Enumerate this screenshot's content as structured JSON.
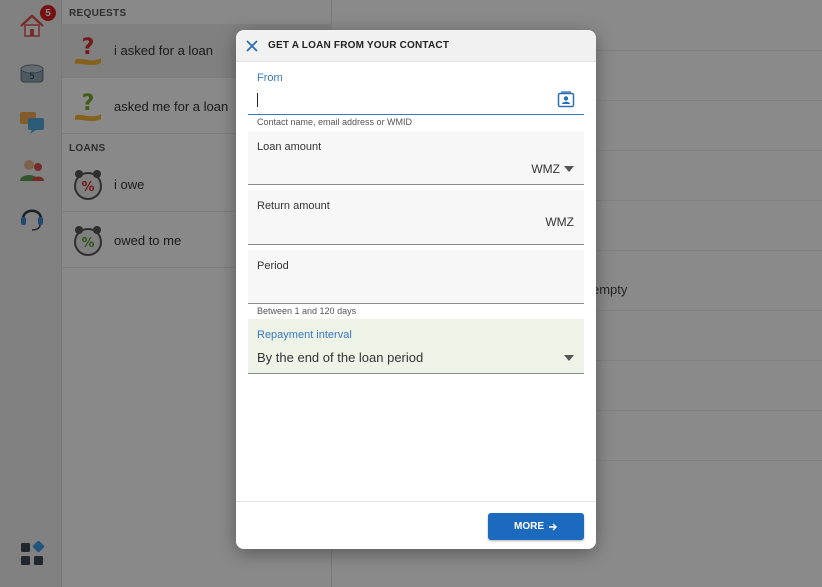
{
  "rail": {
    "badge_count": "5",
    "items": [
      {
        "icon": "home-icon"
      },
      {
        "icon": "safe-icon",
        "label": "5"
      },
      {
        "icon": "chat-icon"
      },
      {
        "icon": "contacts-icon"
      },
      {
        "icon": "support-headset-icon"
      },
      {
        "icon": "apps-grid-icon"
      }
    ]
  },
  "list": {
    "requests_title": "REQUESTS",
    "loans_title": "LOANS",
    "items": [
      {
        "label": "i asked for a loan",
        "icon": "question-hand-icon"
      },
      {
        "label": "asked me for a loan",
        "icon": "question-hand-icon"
      },
      {
        "label": "i owe",
        "icon": "percent-clock-icon"
      },
      {
        "label": "owed to me",
        "icon": "percent-clock-icon"
      }
    ]
  },
  "content": {
    "text": "empty"
  },
  "modal": {
    "title": "GET A LOAN FROM YOUR CONTACT",
    "from": {
      "label": "From",
      "value": "",
      "helper": "Contact name, email address or WMID"
    },
    "loan_amount": {
      "label": "Loan amount",
      "value": "",
      "currency": "WMZ"
    },
    "return_amount": {
      "label": "Return amount",
      "value": "",
      "currency": "WMZ"
    },
    "period": {
      "label": "Period",
      "value": "",
      "helper": "Between 1 and 120 days"
    },
    "repayment_interval": {
      "label": "Repayment interval",
      "value": "By the end of the loan period"
    },
    "more_label": "MORE"
  },
  "colors": {
    "accent": "#1b6ac0",
    "label_blue": "#3a78c3",
    "badge_red": "#d62020",
    "interval_bg": "#eef3e8"
  }
}
